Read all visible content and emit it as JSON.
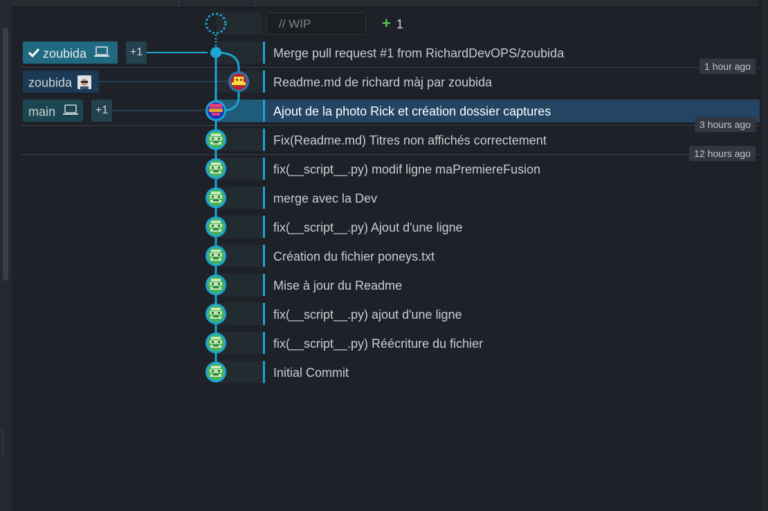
{
  "wip": {
    "label": "// WIP",
    "count": "1"
  },
  "branches": {
    "zoubida_local": {
      "label": "zoubida",
      "extra": "+1"
    },
    "zoubida_remote": {
      "label": "zoubida"
    },
    "main": {
      "label": "main",
      "extra": "+1"
    }
  },
  "commits": [
    {
      "message": "Merge pull request #1 from RichardDevOPS/zoubida"
    },
    {
      "message": "Readme.md de richard màj par zoubida"
    },
    {
      "message": "Ajout de la photo Rick et création dossier captures"
    },
    {
      "message": "Fix(Readme.md) Titres non affichés correctement"
    },
    {
      "message": "fix(__script__.py) modif ligne maPremiereFusion"
    },
    {
      "message": "merge avec la Dev"
    },
    {
      "message": "fix(__script__.py) Ajout d'une ligne"
    },
    {
      "message": "Création du fichier poneys.txt"
    },
    {
      "message": "Mise à jour du Readme"
    },
    {
      "message": "fix(__script__.py) ajout d'une ligne"
    },
    {
      "message": "fix(__script__.py) Réécriture du fichier"
    },
    {
      "message": "Initial Commit"
    }
  ],
  "time_markers": {
    "first": "1 hour ago",
    "second": "3 hours ago",
    "third": "12 hours ago"
  },
  "colors": {
    "accent": "#1da5d3",
    "selected_row": "#244463",
    "branch_local": "#1f6a80",
    "wip_plus": "#5bc451"
  }
}
